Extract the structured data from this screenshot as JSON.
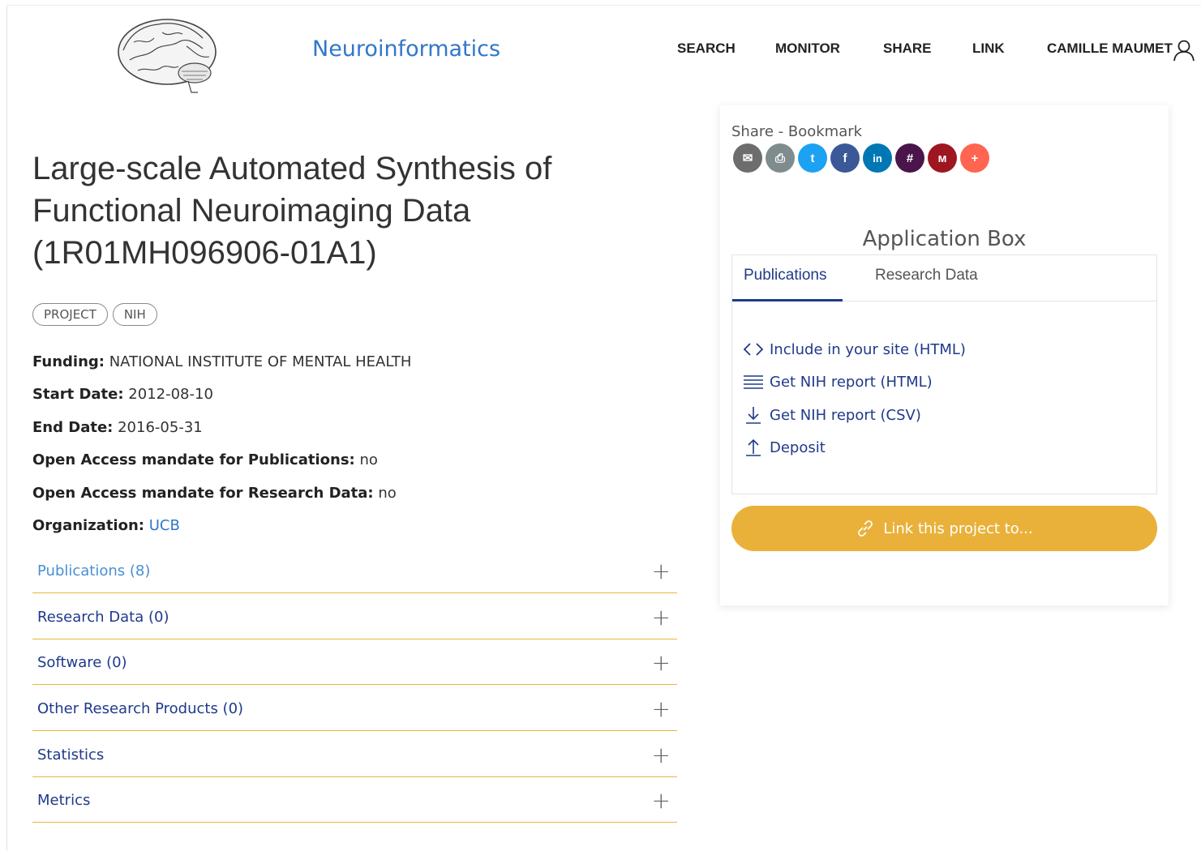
{
  "header": {
    "brand": "Neuroinformatics",
    "nav": [
      "SEARCH",
      "MONITOR",
      "SHARE",
      "LINK"
    ],
    "user": "CAMILLE MAUMET"
  },
  "project": {
    "title": "Large-scale Automated Synthesis of Functional Neuroimaging Data (1R01MH096906-01A1)",
    "badges": [
      "PROJECT",
      "NIH"
    ],
    "fields": [
      {
        "label": "Funding:",
        "value": "NATIONAL INSTITUTE OF MENTAL HEALTH"
      },
      {
        "label": "Start Date:",
        "value": "2012-08-10"
      },
      {
        "label": "End Date:",
        "value": "2016-05-31"
      },
      {
        "label": "Open Access mandate for Publications:",
        "value": "no"
      },
      {
        "label": "Open Access mandate for Research Data:",
        "value": "no"
      },
      {
        "label": "Organization:",
        "value": "UCB"
      }
    ]
  },
  "sections": [
    {
      "label": "Publications (8)"
    },
    {
      "label": "Research Data (0)"
    },
    {
      "label": "Software (0)"
    },
    {
      "label": "Other Research Products (0)"
    },
    {
      "label": "Statistics"
    },
    {
      "label": "Metrics"
    }
  ],
  "share": {
    "title": "Share - Bookmark",
    "buttons": [
      {
        "icon": "email-icon",
        "color": "#6d6d6d",
        "glyph": "✉"
      },
      {
        "icon": "print-icon",
        "color": "#7f8c8d",
        "glyph": "⎙"
      },
      {
        "icon": "twitter-icon",
        "color": "#1da1f2",
        "glyph": "t"
      },
      {
        "icon": "facebook-icon",
        "color": "#3b5998",
        "glyph": "f"
      },
      {
        "icon": "linkedin-icon",
        "color": "#0077b5",
        "glyph": "in"
      },
      {
        "icon": "slack-icon",
        "color": "#4a154b",
        "glyph": "#"
      },
      {
        "icon": "mendeley-icon",
        "color": "#9d1620",
        "glyph": "ᴍ"
      },
      {
        "icon": "more-icon",
        "color": "#ff6550",
        "glyph": "+"
      }
    ]
  },
  "app_box": {
    "title": "Application Box",
    "tabs": [
      "Publications",
      "Research Data"
    ],
    "actions": [
      "Include in your site (HTML)",
      "Get NIH report (HTML)",
      "Get NIH report (CSV)",
      "Deposit"
    ],
    "link_button": "Link this project to..."
  }
}
